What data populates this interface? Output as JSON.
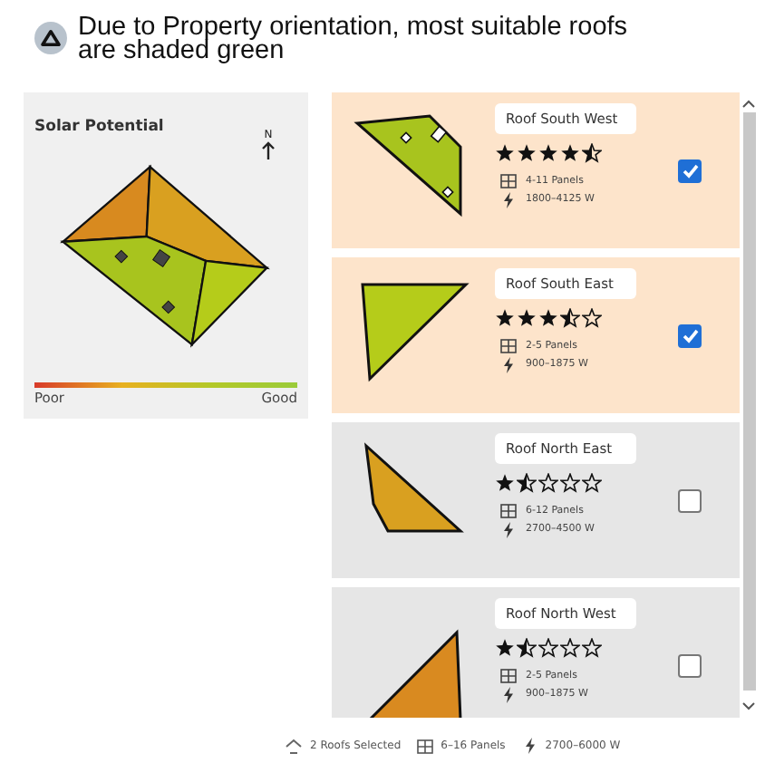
{
  "header": {
    "text": "Due to Property orientation, most suitable roofs are shaded green"
  },
  "solar_potential": {
    "title": "Solar Potential",
    "north": "N",
    "legend_low": "Poor",
    "legend_high": "Good"
  },
  "roofs": [
    {
      "name": "Roof South West",
      "kind": "sw",
      "color": "#a8c41e",
      "stars": 4.5,
      "panels": "4-11 Panels",
      "watts": "1800–4125 W",
      "selected": true
    },
    {
      "name": "Roof South East",
      "kind": "se",
      "color": "#b5cc1a",
      "stars": 3.5,
      "panels": "2-5 Panels",
      "watts": "900–1875 W",
      "selected": true
    },
    {
      "name": "Roof North East",
      "kind": "ne",
      "color": "#d9a020",
      "stars": 1.5,
      "panels": "6-12 Panels",
      "watts": "2700–4500 W",
      "selected": false
    },
    {
      "name": "Roof North West",
      "kind": "nw",
      "color": "#d98a20",
      "stars": 1.5,
      "panels": "2-5 Panels",
      "watts": "900–1875 W",
      "selected": false
    }
  ],
  "summary": {
    "roofs": "2 Roofs Selected",
    "panels": "6–16 Panels",
    "watts": "2700–6000 W"
  }
}
